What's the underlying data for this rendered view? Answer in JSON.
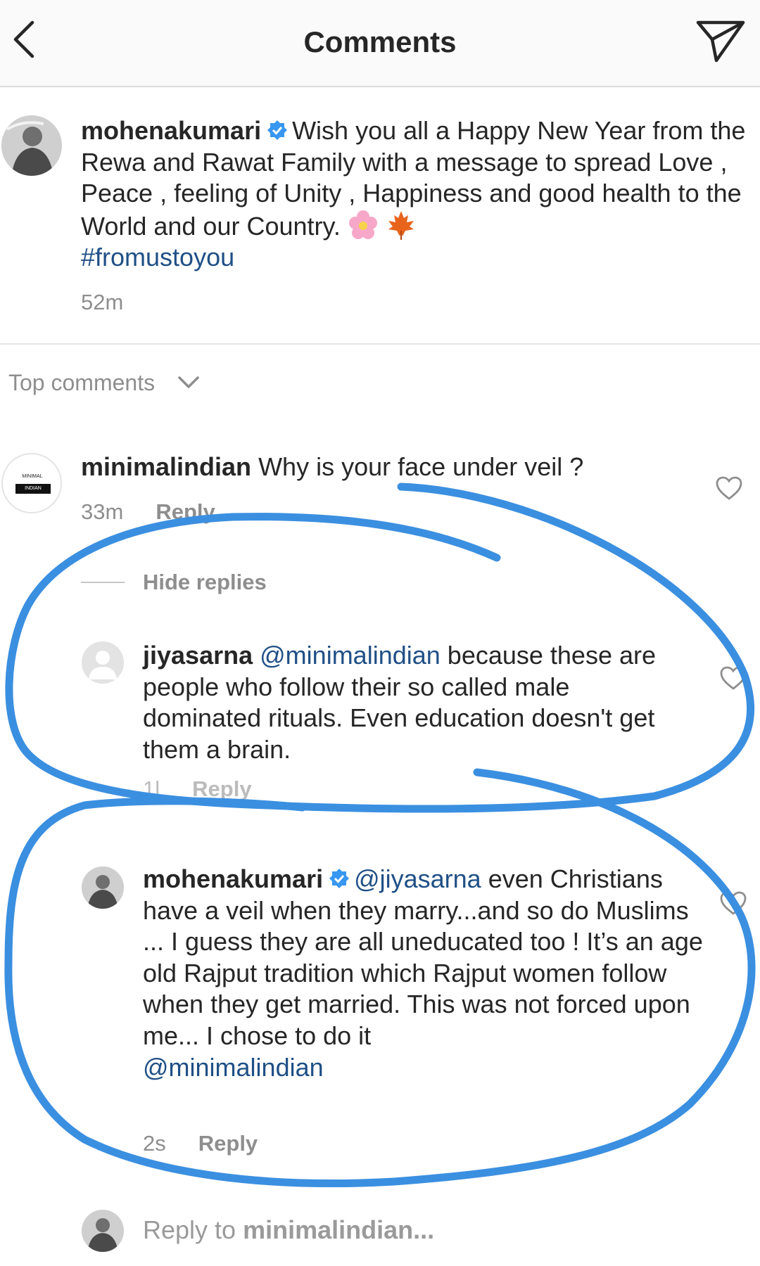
{
  "header": {
    "title": "Comments"
  },
  "post": {
    "username": "mohenakumari",
    "caption": "Wish you all a Happy New Year from the Rewa and Rawat Family with a message to spread Love , Peace , feeling of Unity , Happiness and good health to the World and our Country.",
    "emojis": [
      "flower-emoji",
      "maple-leaf-emoji"
    ],
    "hashtag": "#fromustoyou",
    "time": "52m"
  },
  "sort": {
    "label": "Top comments"
  },
  "comment": {
    "username": "minimalindian",
    "avatar_text_top": "MINIMAL",
    "avatar_text_bottom": "INDIAN",
    "text": "Why is your face under veil ?",
    "time": "33m",
    "reply_label": "Reply"
  },
  "hide_replies": "Hide replies",
  "replies": [
    {
      "username": "jiyasarna",
      "mention": "@minimalindian",
      "text": "because these are people who follow their so called male dominated rituals. Even education doesn't get them a brain.",
      "time": "1l",
      "reply_label": "Reply"
    },
    {
      "username": "mohenakumari",
      "mention": "@jiyasarna",
      "text": "even Christians have a veil when they marry...and so do Muslims ... I guess they are all uneducated too ! It’s an age old Rajput  tradition which Rajput women follow when they get married. This was not forced upon me... I chose to do it",
      "mention_end": "@minimalindian",
      "time": "2s",
      "reply_label": "Reply"
    }
  ],
  "reply_box": {
    "prefix": "Reply to ",
    "username": "minimalindian..."
  },
  "colors": {
    "mention": "#1f4f86",
    "annotation": "#3b8fe0",
    "muted": "#8e8e8e",
    "text": "#262626"
  }
}
